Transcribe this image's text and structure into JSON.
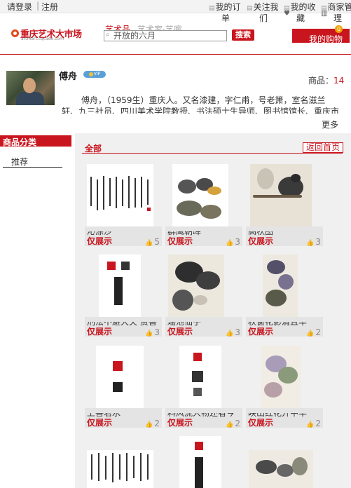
{
  "topbar": {
    "login": "请登录",
    "separator": "|",
    "register": "注册",
    "links": [
      {
        "label": "我的订",
        "wrap": "单",
        "icon": "order-icon"
      },
      {
        "label": "关注我",
        "wrap": "们",
        "icon": "follow-icon"
      },
      {
        "label": "我的收",
        "wrap": "藏",
        "icon": "heart-icon"
      },
      {
        "label": "商家管",
        "wrap": "理",
        "icon": "gear-icon"
      }
    ]
  },
  "header": {
    "logo_text": "重庆艺术大市场",
    "logo_url": "artmart.cqcaee.com",
    "search_tabs": [
      "艺术品",
      "艺术家·艺廊"
    ],
    "search_value": "开放的六月",
    "search_button": "搜索",
    "cart_label": "我的购物",
    "cart_count": "0",
    "colors": {
      "brand": "#c9151e"
    }
  },
  "profile": {
    "name": "傅舟",
    "badge": "VIP",
    "goods_label": "商品：",
    "goods_count": "14",
    "bio_line1": "傅舟，（1959生）重庆人。又名漆建，字仁甫，号老箫，室名滋兰",
    "bio_line2": "轩、九三社员、四川美术学院教授、书法硕士生导师、图书馆馆长、重庆市",
    "more": "更多"
  },
  "sidebar": {
    "title": "商品分类",
    "items": [
      "推荐"
    ]
  },
  "main": {
    "all_label": "全部",
    "back_home": "返回首页",
    "products": [
      {
        "title": "沁涤沙",
        "status": "仅展示",
        "likes": "5"
      },
      {
        "title": "群鹰朝晖",
        "status": "仅展示",
        "likes": "3"
      },
      {
        "title": "高秋图",
        "status": "仅展示",
        "likes": "3"
      },
      {
        "title": "刑法不避大夫 赏善",
        "status": "仅展示",
        "likes": "3"
      },
      {
        "title": "瑶池仙子",
        "status": "仅展示",
        "likes": "3"
      },
      {
        "title": "秋窗花影清且华",
        "status": "仅展示",
        "likes": "2"
      },
      {
        "title": "上善若水",
        "status": "仅展示",
        "likes": "2"
      },
      {
        "title": "料风流人物还看今",
        "status": "仅展示",
        "likes": "2"
      },
      {
        "title": "映山红花开中华",
        "status": "仅展示",
        "likes": "2"
      },
      {
        "title": "",
        "status": "",
        "likes": ""
      },
      {
        "title": "",
        "status": "",
        "likes": ""
      },
      {
        "title": "",
        "status": "",
        "likes": ""
      }
    ]
  }
}
